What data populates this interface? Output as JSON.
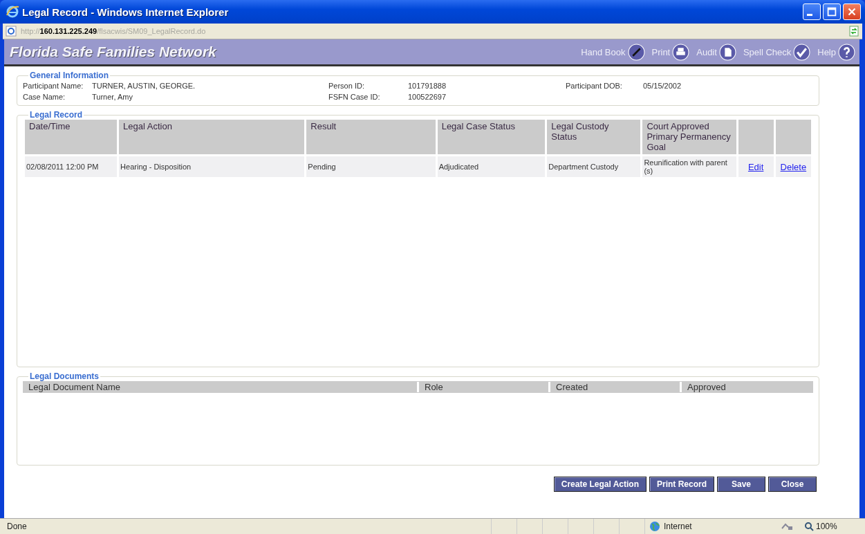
{
  "window": {
    "title": "Legal Record - Windows Internet Explorer"
  },
  "address": {
    "scheme": "http://",
    "host": "160.131.225.249",
    "path": "/flsacwis/SM09_LegalRecord.do"
  },
  "app": {
    "title": "Florida Safe Families Network",
    "tools": [
      {
        "label": "Hand Book",
        "kind": "pen"
      },
      {
        "label": "Print",
        "kind": "printer"
      },
      {
        "label": "Audit",
        "kind": "document"
      },
      {
        "label": "Spell Check",
        "kind": "check"
      },
      {
        "label": "Help",
        "kind": "question"
      }
    ]
  },
  "general_information": {
    "legend": "General Information",
    "fields": [
      {
        "label": "Participant Name:",
        "value": "TURNER, AUSTIN, GEORGE."
      },
      {
        "label": "Person ID:",
        "value": "101791888"
      },
      {
        "label": "Participant DOB:",
        "value": "05/15/2002"
      },
      {
        "label": "Case Name:",
        "value": "Turner, Amy"
      },
      {
        "label": "FSFN Case ID:",
        "value": "100522697"
      }
    ]
  },
  "legal_record": {
    "legend": "Legal Record",
    "columns": [
      "Date/Time",
      "Legal Action",
      "Result",
      "Legal Case Status",
      "Legal Custody Status",
      "Court Approved Primary Permanency Goal"
    ],
    "rows": [
      {
        "cells": [
          "02/08/2011 12:00 PM",
          "Hearing - Disposition",
          "Pending",
          "Adjudicated",
          "Department Custody",
          "Reunification with parent (s)"
        ],
        "links": [
          "Edit",
          "Delete"
        ]
      }
    ]
  },
  "legal_documents": {
    "legend": "Legal Documents",
    "columns": [
      "Legal Document Name",
      "Role",
      "Created",
      "Approved"
    ]
  },
  "buttons": [
    "Create Legal Action",
    "Print Record",
    "Save",
    "Close"
  ],
  "status_bar": {
    "text": "Done",
    "zone": "Internet",
    "zoom": "100%"
  }
}
